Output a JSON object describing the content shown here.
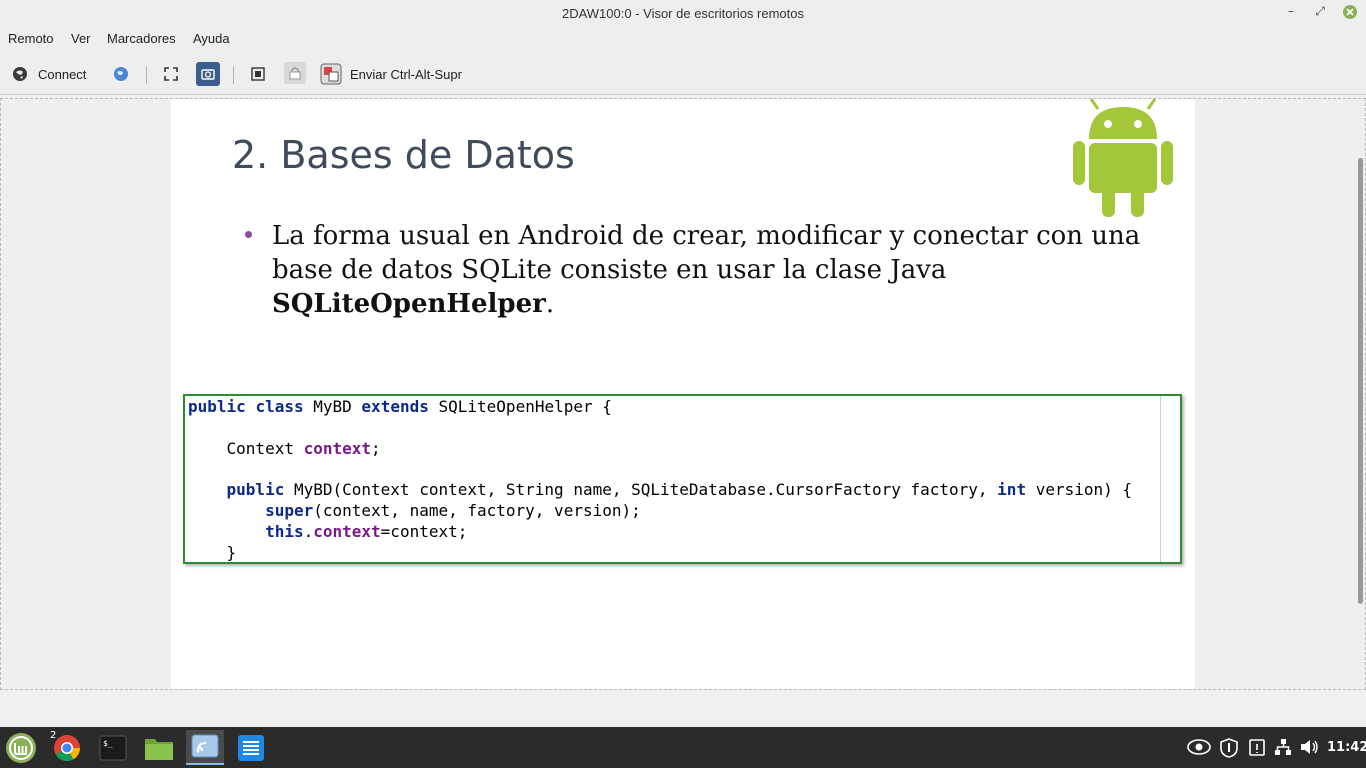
{
  "window": {
    "title": "2DAW100:0 - Visor de escritorios remotos",
    "controls": {
      "minimize": "–",
      "maximize": "⤢",
      "close": "✕"
    }
  },
  "menu": [
    "Remoto",
    "Ver",
    "Marcadores",
    "Ayuda"
  ],
  "toolbar": {
    "connect_label": "Connect",
    "ctrl_alt_del_label": "Enviar Ctrl-Alt-Supr",
    "icons": [
      "connect-icon",
      "globe-icon",
      "fullscreen-icon",
      "screenshot-icon",
      "scale-icon",
      "lock-icon",
      "keyboard-icon"
    ]
  },
  "slide": {
    "title": "2. Bases de Datos",
    "bullet_text": "La forma usual en Android de crear, modificar y conectar con una base de datos SQLite consiste en usar la clase Java",
    "bullet_bold": "SQLiteOpenHelper",
    "bullet_end": ".",
    "code": {
      "line1": {
        "kw1": "public",
        "kw2": "class",
        "t1": "MyBD",
        "kw3": "extends",
        "t2": "SQLiteOpenHelper {"
      },
      "line2": {
        "t1": "Context",
        "f1": "context",
        "t2": ";"
      },
      "line3": {
        "kw1": "public",
        "t1": "MyBD(Context context, String name, SQLiteDatabase.CursorFactory factory,",
        "kw2": "int",
        "t2": "version) {"
      },
      "line4": {
        "kw1": "super",
        "t1": "(context, name, factory, version);"
      },
      "line5": {
        "kw1": "this",
        "t1": ".",
        "f1": "context",
        "t2": "=context;"
      },
      "line6": {
        "t1": "}"
      }
    }
  },
  "taskbar": {
    "apps": [
      "mint-menu-icon",
      "chrome-icon",
      "terminal-icon",
      "files-icon",
      "remote-viewer-icon",
      "text-editor-icon"
    ],
    "chrome_badge": "2",
    "clock": "11:42",
    "tray": [
      "eye-icon",
      "shield-icon",
      "clipboard-icon",
      "network-icon",
      "volume-icon"
    ]
  },
  "colors": {
    "android_green": "#a4c639",
    "code_border": "#2e8b2e",
    "keyword": "#0c2a8a",
    "field": "#7a1a8a",
    "bullet": "#8e4a9e"
  }
}
